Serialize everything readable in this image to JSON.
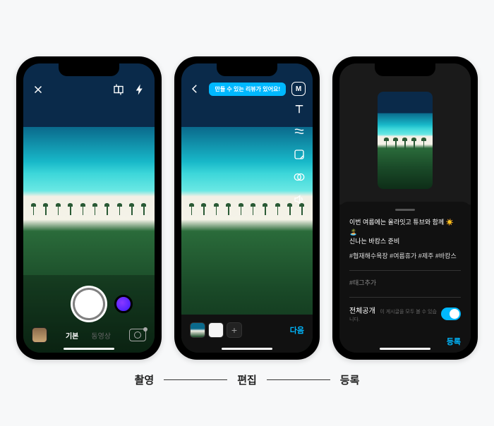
{
  "phone1": {
    "tabs": {
      "active": "기본",
      "inactive": "동영상"
    }
  },
  "phone2": {
    "tooltip": "만들 수 있는 리뷰가 있어요!",
    "badge": "M",
    "next": "다음"
  },
  "phone3": {
    "caption_line1": "이번 여름에는 올라잇고 튜브와 함께 ☀️🏝️",
    "caption_line2": "신나는 바캉스 준비",
    "hashtags": "#협재해수욕장 #여름휴가 #제주 #바캉스",
    "add_tag": "#태그추가",
    "visibility_label": "전체공개",
    "visibility_hint": "이 게시글을 모두 볼 수 있습니다.",
    "submit": "등록"
  },
  "steps": {
    "shoot": "촬영",
    "edit": "편집",
    "publish": "등록"
  }
}
